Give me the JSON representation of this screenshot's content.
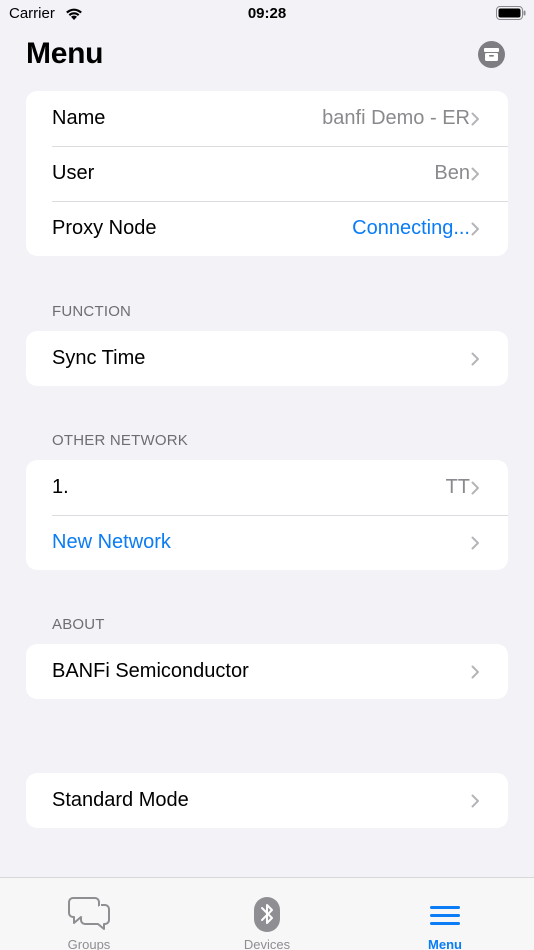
{
  "status_bar": {
    "carrier": "Carrier",
    "time": "09:28"
  },
  "header": {
    "title": "Menu",
    "action_icon": "archive-icon"
  },
  "main_group": [
    {
      "label": "Name",
      "value": "banfi Demo - ER"
    },
    {
      "label": "User",
      "value": "Ben"
    },
    {
      "label": "Proxy Node",
      "value": "Connecting..."
    }
  ],
  "function": {
    "header": "FUNCTION",
    "items": [
      {
        "label": "Sync Time"
      }
    ]
  },
  "other_network": {
    "header": "OTHER NETWORK",
    "items": [
      {
        "label": "1.",
        "value": "TT"
      },
      {
        "label": "New Network"
      }
    ]
  },
  "about": {
    "header": "ABOUT",
    "items": [
      {
        "label": "BANFi Semiconductor"
      }
    ]
  },
  "mode": {
    "items": [
      {
        "label": "Standard Mode"
      }
    ]
  },
  "tab_bar": {
    "tabs": [
      {
        "label": "Groups",
        "icon": "chat-bubbles-icon"
      },
      {
        "label": "Devices",
        "icon": "bluetooth-icon"
      },
      {
        "label": "Menu",
        "icon": "hamburger-menu-icon",
        "active": true
      }
    ]
  },
  "colors": {
    "accent": "#0a7cf5",
    "background": "#f2f2f7",
    "secondary_text": "#8a8a8e"
  }
}
